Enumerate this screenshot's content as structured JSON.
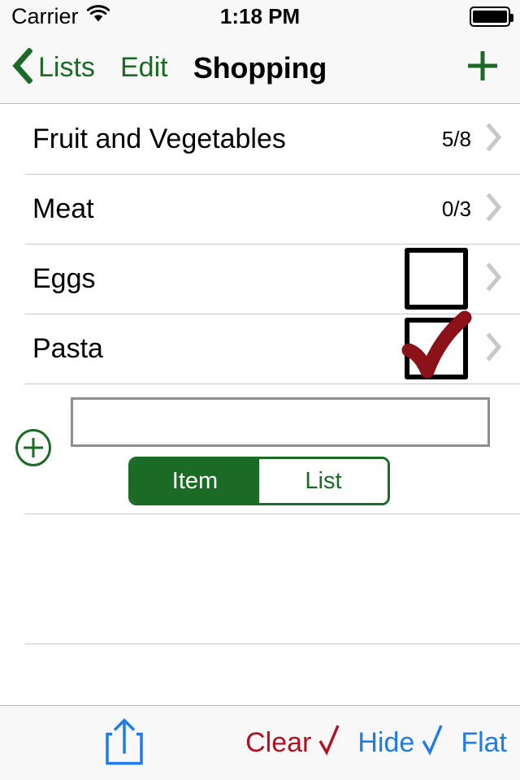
{
  "status_bar": {
    "carrier": "Carrier",
    "time": "1:18 PM",
    "wifi_icon": "wifi-icon",
    "battery_icon": "battery-full-icon"
  },
  "nav_bar": {
    "back_icon": "chevron-left-icon",
    "back_label": "Lists",
    "edit_label": "Edit",
    "title": "Shopping",
    "add_icon": "plus-icon"
  },
  "list": {
    "rows": [
      {
        "title": "Fruit and Vegetables",
        "count": "5/8",
        "type": "sublist",
        "accessory_icon": "chevron-right-icon"
      },
      {
        "title": "Meat",
        "count": "0/3",
        "type": "sublist",
        "accessory_icon": "chevron-right-icon"
      },
      {
        "title": "Eggs",
        "count": "",
        "type": "item",
        "checked": false,
        "accessory_icon": "chevron-right-icon"
      },
      {
        "title": "Pasta",
        "count": "",
        "type": "item",
        "checked": true,
        "accessory_icon": "chevron-right-icon"
      }
    ]
  },
  "add_row": {
    "add_icon": "plus-circle-icon",
    "input_value": "",
    "input_placeholder": "",
    "segments": [
      {
        "label": "Item",
        "selected": true
      },
      {
        "label": "List",
        "selected": false
      }
    ]
  },
  "toolbar": {
    "share_icon": "share-icon",
    "clear_label": "Clear",
    "clear_icon": "checkmark-icon",
    "hide_label": "Hide",
    "hide_icon": "checkmark-icon",
    "flat_label": "Flat"
  },
  "colors": {
    "accent_green": "#1B6B26",
    "accent_blue": "#1E7BE8",
    "danger_red": "#B01020",
    "check_red": "#8B1218",
    "separator": "#c8c7cc",
    "bar_background": "#f8f8f8"
  }
}
